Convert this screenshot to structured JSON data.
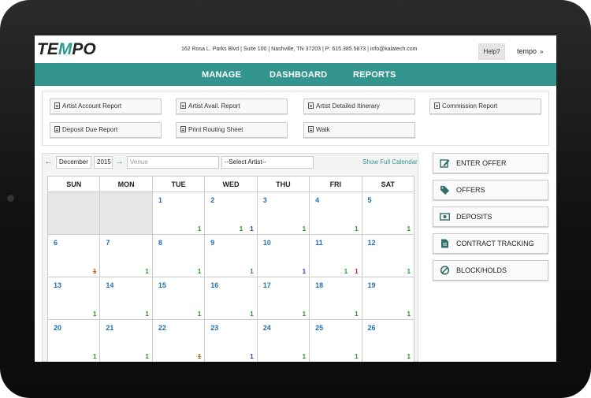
{
  "brand": {
    "logo_text": "TEMPO",
    "accent": "#34958f",
    "day_number_color": "#1f6fb5"
  },
  "header": {
    "address": "162 Rosa L. Parks Blvd | Suite 100 | Nashville, TN 37203 | P: 615.385.5873 | info@kalatech.com",
    "help_label": "Help?",
    "user_label": "tempo"
  },
  "nav": {
    "items": [
      "MANAGE",
      "DASHBOARD",
      "REPORTS"
    ]
  },
  "reports": {
    "buttons": [
      "Artist Account Report",
      "Artist Avail. Report",
      "Artist Detailed Itinerary",
      "Commission Report",
      "Deposit Due Report",
      "Print Routing Sheet",
      "Walk"
    ]
  },
  "calendar": {
    "month": "December",
    "year": "2015",
    "venue_placeholder": "Venue",
    "artist_select": "--Select Artist--",
    "show_full_label": "Show Full Calendar",
    "weekdays": [
      "SUN",
      "MON",
      "TUE",
      "WED",
      "THU",
      "FRI",
      "SAT"
    ],
    "weeks": [
      [
        {
          "day": ""
        },
        {
          "day": ""
        },
        {
          "day": "1",
          "counts": [
            {
              "n": "1",
              "c": "#1a9a1a"
            }
          ]
        },
        {
          "day": "2",
          "counts": [
            {
              "n": "1",
              "c": "#1a9a1a"
            },
            {
              "n": "1",
              "c": "#1f3fbf"
            }
          ]
        },
        {
          "day": "3",
          "counts": [
            {
              "n": "1",
              "c": "#1a9a1a"
            }
          ]
        },
        {
          "day": "4",
          "counts": [
            {
              "n": "1",
              "c": "#1a9a1a"
            }
          ]
        },
        {
          "day": "5",
          "counts": [
            {
              "n": "1",
              "c": "#1a9a1a"
            }
          ]
        }
      ],
      [
        {
          "day": "6",
          "counts": [
            {
              "n": "1",
              "c": "#b5651d",
              "strike": true
            }
          ]
        },
        {
          "day": "7",
          "counts": [
            {
              "n": "1",
              "c": "#1a9a1a"
            }
          ]
        },
        {
          "day": "8",
          "counts": [
            {
              "n": "1",
              "c": "#1a9a1a"
            }
          ]
        },
        {
          "day": "9",
          "counts": [
            {
              "n": "1",
              "c": "#1a9a1a"
            }
          ]
        },
        {
          "day": "10",
          "counts": [
            {
              "n": "1",
              "c": "#1f3fbf"
            }
          ]
        },
        {
          "day": "11",
          "counts": [
            {
              "n": "1",
              "c": "#1a9a1a"
            },
            {
              "n": "1",
              "c": "#d22"
            }
          ]
        },
        {
          "day": "12",
          "counts": [
            {
              "n": "1",
              "c": "#1a9a1a"
            }
          ]
        }
      ],
      [
        {
          "day": "13",
          "counts": [
            {
              "n": "1",
              "c": "#1a9a1a"
            }
          ]
        },
        {
          "day": "14",
          "counts": [
            {
              "n": "1",
              "c": "#1a9a1a"
            }
          ]
        },
        {
          "day": "15",
          "counts": [
            {
              "n": "1",
              "c": "#1a9a1a"
            }
          ]
        },
        {
          "day": "16",
          "counts": [
            {
              "n": "1",
              "c": "#1a9a1a"
            }
          ]
        },
        {
          "day": "17",
          "counts": [
            {
              "n": "1",
              "c": "#1a9a1a"
            }
          ]
        },
        {
          "day": "18",
          "counts": [
            {
              "n": "1",
              "c": "#1a9a1a"
            }
          ]
        },
        {
          "day": "19",
          "counts": [
            {
              "n": "1",
              "c": "#1a9a1a"
            }
          ]
        }
      ],
      [
        {
          "day": "20",
          "counts": [
            {
              "n": "1",
              "c": "#1a9a1a"
            }
          ]
        },
        {
          "day": "21",
          "counts": [
            {
              "n": "1",
              "c": "#1a9a1a"
            }
          ]
        },
        {
          "day": "22",
          "counts": [
            {
              "n": "1",
              "c": "#b5651d",
              "strike": true
            }
          ]
        },
        {
          "day": "23",
          "counts": [
            {
              "n": "1",
              "c": "#1f3fbf"
            }
          ]
        },
        {
          "day": "24",
          "counts": [
            {
              "n": "1",
              "c": "#1a9a1a"
            }
          ]
        },
        {
          "day": "25",
          "counts": [
            {
              "n": "1",
              "c": "#1a9a1a"
            }
          ]
        },
        {
          "day": "26",
          "counts": [
            {
              "n": "1",
              "c": "#1a9a1a"
            }
          ]
        }
      ]
    ]
  },
  "actions": [
    {
      "label": "ENTER OFFER",
      "icon": "edit-icon"
    },
    {
      "label": "OFFERS",
      "icon": "tags-icon"
    },
    {
      "label": "DEPOSITS",
      "icon": "money-icon"
    },
    {
      "label": "CONTRACT TRACKING",
      "icon": "document-icon"
    },
    {
      "label": "BLOCK/HOLDS",
      "icon": "ban-icon"
    }
  ]
}
